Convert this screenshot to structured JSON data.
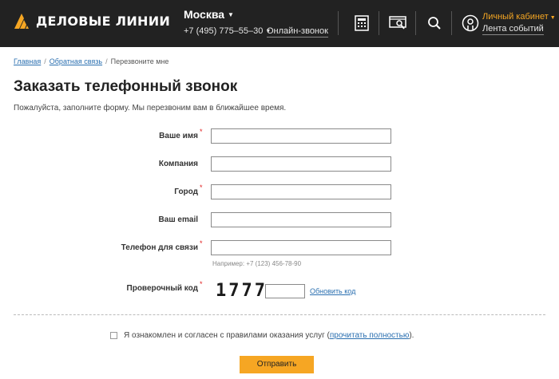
{
  "header": {
    "logo_text": "ДЕЛОВЫЕ ЛИНИИ",
    "city": "Москва",
    "phone": "+7 (495) 775–55–30",
    "online_call": "Онлайн-звонок",
    "icons": [
      "calculator-icon",
      "tracking-icon",
      "search-icon",
      "account-icon"
    ],
    "cabinet": "Личный кабинет",
    "events": "Лента событий",
    "colors": {
      "bg": "#222222",
      "accent": "#f5a623"
    }
  },
  "breadcrumb": {
    "items": [
      "Главная",
      "Обратная связь",
      "Перезвоните мне"
    ]
  },
  "page": {
    "title": "Заказать телефонный звонок",
    "subtitle": "Пожалуйста, заполните форму. Мы перезвоним вам в ближайшее время."
  },
  "form": {
    "fields": [
      {
        "label": "Ваше имя",
        "required": true,
        "value": ""
      },
      {
        "label": "Компания",
        "required": false,
        "value": ""
      },
      {
        "label": "Город",
        "required": true,
        "value": ""
      },
      {
        "label": "Ваш email",
        "required": false,
        "value": ""
      },
      {
        "label": "Телефон для связи",
        "required": true,
        "value": ""
      }
    ],
    "phone_hint": "Например: +7 (123) 456-78-90",
    "captcha_label": "Проверочный код",
    "captcha_code": "1777",
    "captcha_value": "",
    "captcha_refresh": "Обновить код",
    "agree_text": "Я ознакомлен и согласен с правилами оказания услуг (",
    "agree_link": "прочитать полностью",
    "agree_end": ").",
    "agree_checked": false,
    "submit": "Отправить",
    "required_mark": "*"
  }
}
